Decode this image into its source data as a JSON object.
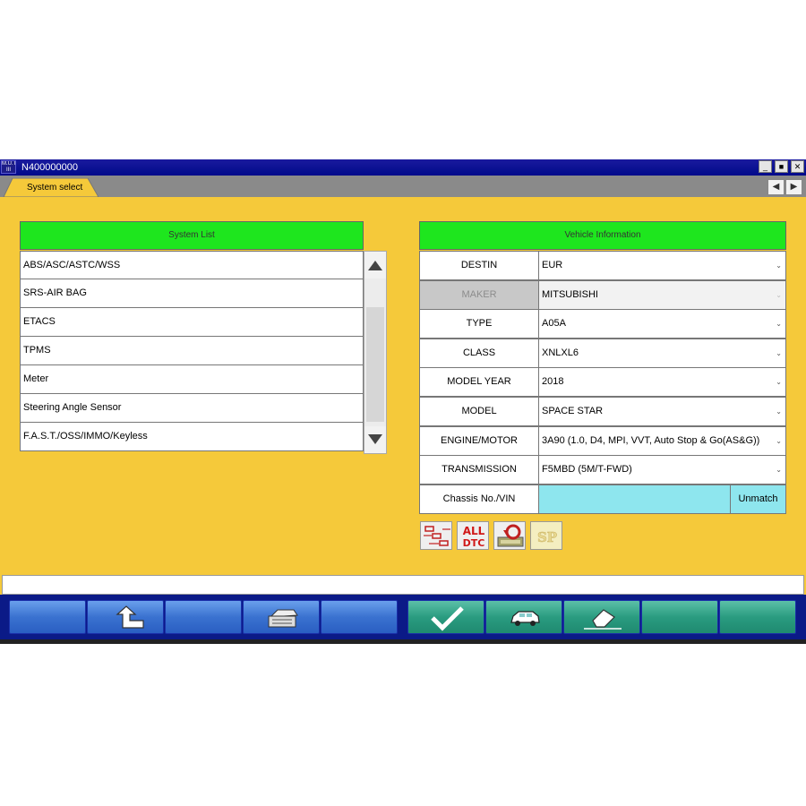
{
  "window": {
    "title": "N400000000",
    "app_icon_text": "M.U.T. III",
    "minimize": "_",
    "maximize": "■",
    "close": "✕"
  },
  "tab": {
    "label": "System select"
  },
  "nav": {
    "prev": "◀",
    "next": "▶"
  },
  "system_list": {
    "header": "System List",
    "items": [
      "ABS/ASC/ASTC/WSS",
      "SRS-AIR BAG",
      "ETACS",
      "TPMS",
      "Meter",
      "Steering Angle Sensor",
      "F.A.S.T./OSS/IMMO/Keyless"
    ]
  },
  "vehicle_info": {
    "header": "Vehicle Information",
    "rows": [
      {
        "label": "DESTIN",
        "value": "EUR"
      },
      {
        "label": "MAKER",
        "value": "MITSUBISHI"
      },
      {
        "label": "TYPE",
        "value": "A05A"
      },
      {
        "label": "CLASS",
        "value": "XNLXL6"
      },
      {
        "label": "MODEL YEAR",
        "value": "2018"
      },
      {
        "label": "MODEL",
        "value": "SPACE STAR"
      },
      {
        "label": "ENGINE/MOTOR",
        "value": "3A90 (1.0, D4, MPI, VVT, Auto Stop & Go(AS&G))"
      },
      {
        "label": "TRANSMISSION",
        "value": "F5MBD (5M/T-FWD)"
      }
    ],
    "vin": {
      "label": "Chassis No./VIN",
      "value": "",
      "button": "Unmatch"
    }
  },
  "tools": {
    "all_dtc_line1": "ALL",
    "all_dtc_line2": "DTC",
    "sp": "SP"
  },
  "dropdown_glyph": "⌄",
  "colors": {
    "background": "#f5c93a",
    "header_green": "#1ee61e",
    "title_bar": "#000a8a",
    "vin_field": "#8ee6ee"
  }
}
